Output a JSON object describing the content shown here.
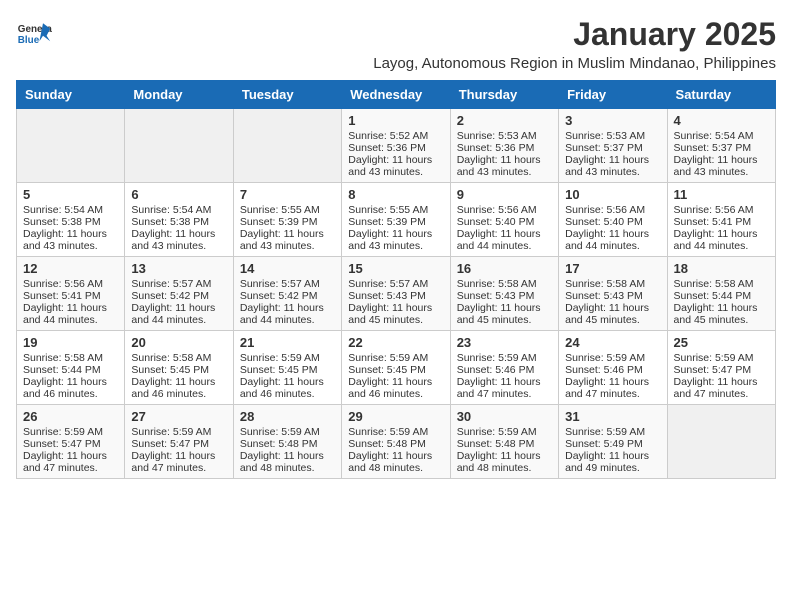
{
  "header": {
    "logo_line1": "General",
    "logo_line2": "Blue",
    "main_title": "January 2025",
    "subtitle": "Layog, Autonomous Region in Muslim Mindanao, Philippines"
  },
  "weekdays": [
    "Sunday",
    "Monday",
    "Tuesday",
    "Wednesday",
    "Thursday",
    "Friday",
    "Saturday"
  ],
  "weeks": [
    [
      {
        "day": "",
        "info": ""
      },
      {
        "day": "",
        "info": ""
      },
      {
        "day": "",
        "info": ""
      },
      {
        "day": "1",
        "info": "Sunrise: 5:52 AM\nSunset: 5:36 PM\nDaylight: 11 hours and 43 minutes."
      },
      {
        "day": "2",
        "info": "Sunrise: 5:53 AM\nSunset: 5:36 PM\nDaylight: 11 hours and 43 minutes."
      },
      {
        "day": "3",
        "info": "Sunrise: 5:53 AM\nSunset: 5:37 PM\nDaylight: 11 hours and 43 minutes."
      },
      {
        "day": "4",
        "info": "Sunrise: 5:54 AM\nSunset: 5:37 PM\nDaylight: 11 hours and 43 minutes."
      }
    ],
    [
      {
        "day": "5",
        "info": "Sunrise: 5:54 AM\nSunset: 5:38 PM\nDaylight: 11 hours and 43 minutes."
      },
      {
        "day": "6",
        "info": "Sunrise: 5:54 AM\nSunset: 5:38 PM\nDaylight: 11 hours and 43 minutes."
      },
      {
        "day": "7",
        "info": "Sunrise: 5:55 AM\nSunset: 5:39 PM\nDaylight: 11 hours and 43 minutes."
      },
      {
        "day": "8",
        "info": "Sunrise: 5:55 AM\nSunset: 5:39 PM\nDaylight: 11 hours and 43 minutes."
      },
      {
        "day": "9",
        "info": "Sunrise: 5:56 AM\nSunset: 5:40 PM\nDaylight: 11 hours and 44 minutes."
      },
      {
        "day": "10",
        "info": "Sunrise: 5:56 AM\nSunset: 5:40 PM\nDaylight: 11 hours and 44 minutes."
      },
      {
        "day": "11",
        "info": "Sunrise: 5:56 AM\nSunset: 5:41 PM\nDaylight: 11 hours and 44 minutes."
      }
    ],
    [
      {
        "day": "12",
        "info": "Sunrise: 5:56 AM\nSunset: 5:41 PM\nDaylight: 11 hours and 44 minutes."
      },
      {
        "day": "13",
        "info": "Sunrise: 5:57 AM\nSunset: 5:42 PM\nDaylight: 11 hours and 44 minutes."
      },
      {
        "day": "14",
        "info": "Sunrise: 5:57 AM\nSunset: 5:42 PM\nDaylight: 11 hours and 44 minutes."
      },
      {
        "day": "15",
        "info": "Sunrise: 5:57 AM\nSunset: 5:43 PM\nDaylight: 11 hours and 45 minutes."
      },
      {
        "day": "16",
        "info": "Sunrise: 5:58 AM\nSunset: 5:43 PM\nDaylight: 11 hours and 45 minutes."
      },
      {
        "day": "17",
        "info": "Sunrise: 5:58 AM\nSunset: 5:43 PM\nDaylight: 11 hours and 45 minutes."
      },
      {
        "day": "18",
        "info": "Sunrise: 5:58 AM\nSunset: 5:44 PM\nDaylight: 11 hours and 45 minutes."
      }
    ],
    [
      {
        "day": "19",
        "info": "Sunrise: 5:58 AM\nSunset: 5:44 PM\nDaylight: 11 hours and 46 minutes."
      },
      {
        "day": "20",
        "info": "Sunrise: 5:58 AM\nSunset: 5:45 PM\nDaylight: 11 hours and 46 minutes."
      },
      {
        "day": "21",
        "info": "Sunrise: 5:59 AM\nSunset: 5:45 PM\nDaylight: 11 hours and 46 minutes."
      },
      {
        "day": "22",
        "info": "Sunrise: 5:59 AM\nSunset: 5:45 PM\nDaylight: 11 hours and 46 minutes."
      },
      {
        "day": "23",
        "info": "Sunrise: 5:59 AM\nSunset: 5:46 PM\nDaylight: 11 hours and 47 minutes."
      },
      {
        "day": "24",
        "info": "Sunrise: 5:59 AM\nSunset: 5:46 PM\nDaylight: 11 hours and 47 minutes."
      },
      {
        "day": "25",
        "info": "Sunrise: 5:59 AM\nSunset: 5:47 PM\nDaylight: 11 hours and 47 minutes."
      }
    ],
    [
      {
        "day": "26",
        "info": "Sunrise: 5:59 AM\nSunset: 5:47 PM\nDaylight: 11 hours and 47 minutes."
      },
      {
        "day": "27",
        "info": "Sunrise: 5:59 AM\nSunset: 5:47 PM\nDaylight: 11 hours and 47 minutes."
      },
      {
        "day": "28",
        "info": "Sunrise: 5:59 AM\nSunset: 5:48 PM\nDaylight: 11 hours and 48 minutes."
      },
      {
        "day": "29",
        "info": "Sunrise: 5:59 AM\nSunset: 5:48 PM\nDaylight: 11 hours and 48 minutes."
      },
      {
        "day": "30",
        "info": "Sunrise: 5:59 AM\nSunset: 5:48 PM\nDaylight: 11 hours and 48 minutes."
      },
      {
        "day": "31",
        "info": "Sunrise: 5:59 AM\nSunset: 5:49 PM\nDaylight: 11 hours and 49 minutes."
      },
      {
        "day": "",
        "info": ""
      }
    ]
  ]
}
